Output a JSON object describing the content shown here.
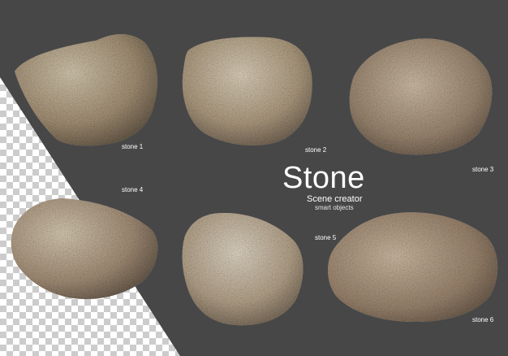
{
  "title": "Stone",
  "subtitle": "Scene creator",
  "subsubtitle": "smart objects",
  "labels": [
    "stone 1",
    "stone 2",
    "stone 3",
    "stone 4",
    "stone 5",
    "stone 6"
  ],
  "colors": {
    "backdrop": "#474747",
    "transparency_checker_light": "#ffffff",
    "transparency_checker_dark": "#cccccc",
    "text": "#ffffff"
  }
}
